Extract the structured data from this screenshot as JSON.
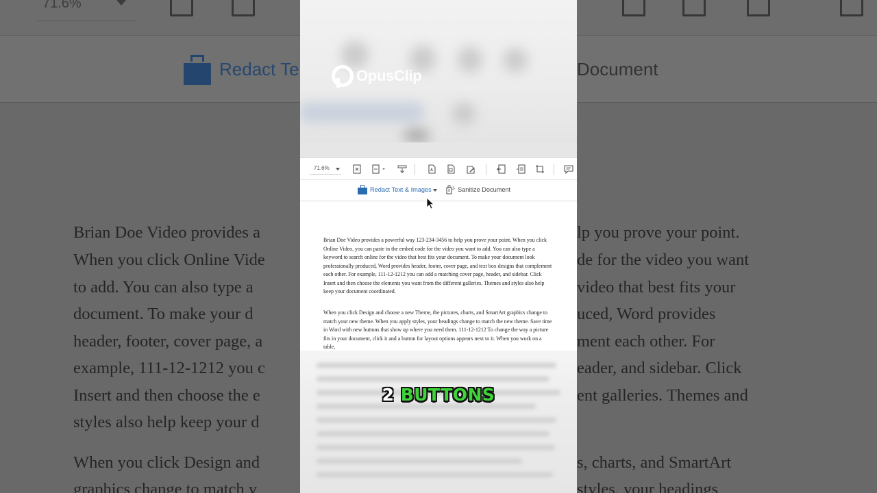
{
  "toolbar": {
    "zoom_value": "71.6%",
    "icons": [
      "fit-page-icon",
      "fit-width-icon",
      "scroll-icon",
      "pdf-icon",
      "export-icon",
      "edit-icon",
      "extract-icon",
      "insert-pages-icon",
      "crop-icon",
      "comment-icon"
    ]
  },
  "ribbon": {
    "redact_label": "Redact Text & Images",
    "sanitize_label": "Sanitize Document",
    "bg_redact_label": "Redact Te",
    "bg_document_label": "Document"
  },
  "watermark": {
    "text": "OpusClip"
  },
  "document": {
    "paragraph1": "Brian Doe Video provides a powerful way 123-234-3456 to help you prove your point. When you click Online Video, you can paste in the embed code for the video you want to add. You can also type a keyword to search online for the video that best fits your document. To make your document look professionally produced, Word provides header, footer, cover page, and text box designs that complement each other. For example, 111-12-1212 you can add a matching cover page, header, and sidebar. Click Insert and then choose the elements you want from the different galleries. Themes and styles also help keep your document coordinated.",
    "paragraph2": "When you click Design and choose a new Theme, the pictures, charts, and SmartArt graphics change to match your new theme. When you apply styles, your headings change to match the new theme. Save time in Word with new buttons that show up where you need them. 111-12-1212 To change the way a picture fits in your document, click it and a button for layout options appears next to it. When you work on a table,"
  },
  "background_document": {
    "lines": [
      [
        "Brian Doe Video provides a",
        "lp you prove your point."
      ],
      [
        "When you click Online Vide",
        "de for the video you want"
      ],
      [
        "to add. You can also type a",
        "video that best fits your"
      ],
      [
        "document. To make your d",
        "uced, Word provides"
      ],
      [
        "header, footer, cover page, a",
        "ment each other. For"
      ],
      [
        "example, 111-12-1212 you c",
        "eader, and sidebar. Click"
      ],
      [
        "Insert and then choose the e",
        "ent galleries. Themes and"
      ],
      [
        "styles also help keep your d",
        ""
      ],
      [
        "When you click Design and",
        "s, charts, and SmartArt"
      ],
      [
        "graphics change to match y",
        "styles, your headings"
      ]
    ]
  },
  "caption": {
    "number": "2",
    "word": "BUTTONS"
  },
  "colors": {
    "accent_blue": "#2b6cb0",
    "caption_green": "#3fd33a"
  }
}
